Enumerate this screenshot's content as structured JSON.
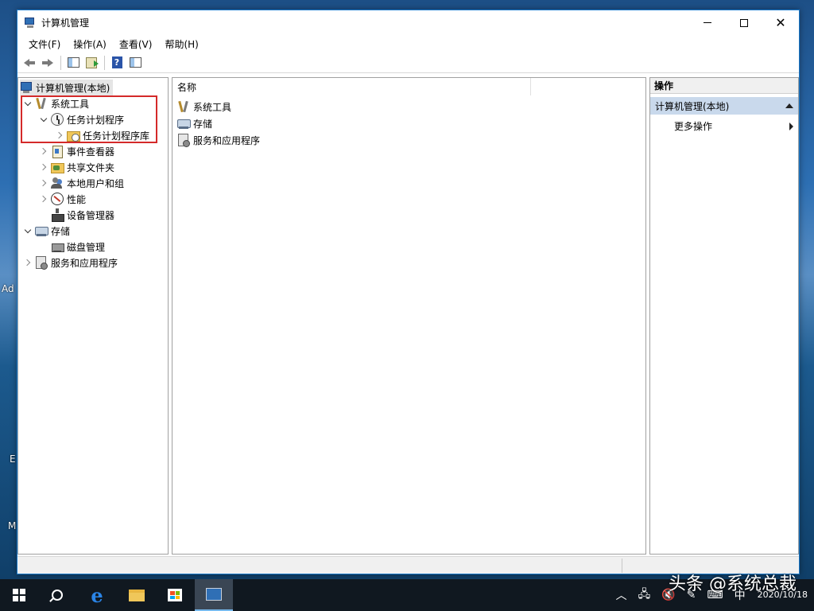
{
  "desktop": {
    "left_fragments": [
      "Ad",
      "E",
      "M"
    ]
  },
  "window": {
    "title": "计算机管理",
    "menu": [
      "文件(F)",
      "操作(A)",
      "查看(V)",
      "帮助(H)"
    ]
  },
  "tree": {
    "root": "计算机管理(本地)",
    "items": [
      {
        "label": "系统工具",
        "expanded": "open",
        "icon": "tools-icon"
      },
      {
        "label": "任务计划程序",
        "expanded": "open",
        "icon": "clock-icon"
      },
      {
        "label": "任务计划程序库",
        "expanded": "closed",
        "icon": "folder-clock-icon"
      },
      {
        "label": "事件查看器",
        "expanded": "closed",
        "icon": "event-viewer-icon"
      },
      {
        "label": "共享文件夹",
        "expanded": "closed",
        "icon": "shared-folder-icon"
      },
      {
        "label": "本地用户和组",
        "expanded": "closed",
        "icon": "users-icon"
      },
      {
        "label": "性能",
        "expanded": "closed",
        "icon": "performance-icon"
      },
      {
        "label": "设备管理器",
        "expanded": "none",
        "icon": "device-manager-icon"
      },
      {
        "label": "存储",
        "expanded": "open",
        "icon": "storage-icon"
      },
      {
        "label": "磁盘管理",
        "expanded": "none",
        "icon": "disk-icon"
      },
      {
        "label": "服务和应用程序",
        "expanded": "closed",
        "icon": "services-icon"
      }
    ]
  },
  "list": {
    "column_header": "名称",
    "rows": [
      "系统工具",
      "存储",
      "服务和应用程序"
    ]
  },
  "actions": {
    "header": "操作",
    "section": "计算机管理(本地)",
    "items": [
      "更多操作"
    ]
  },
  "taskbar": {
    "apps": [
      "start",
      "search",
      "edge",
      "file-explorer",
      "store",
      "computer-management"
    ],
    "input_method": "中",
    "date": "2020/10/18"
  },
  "watermark": "头条 @系统总裁"
}
